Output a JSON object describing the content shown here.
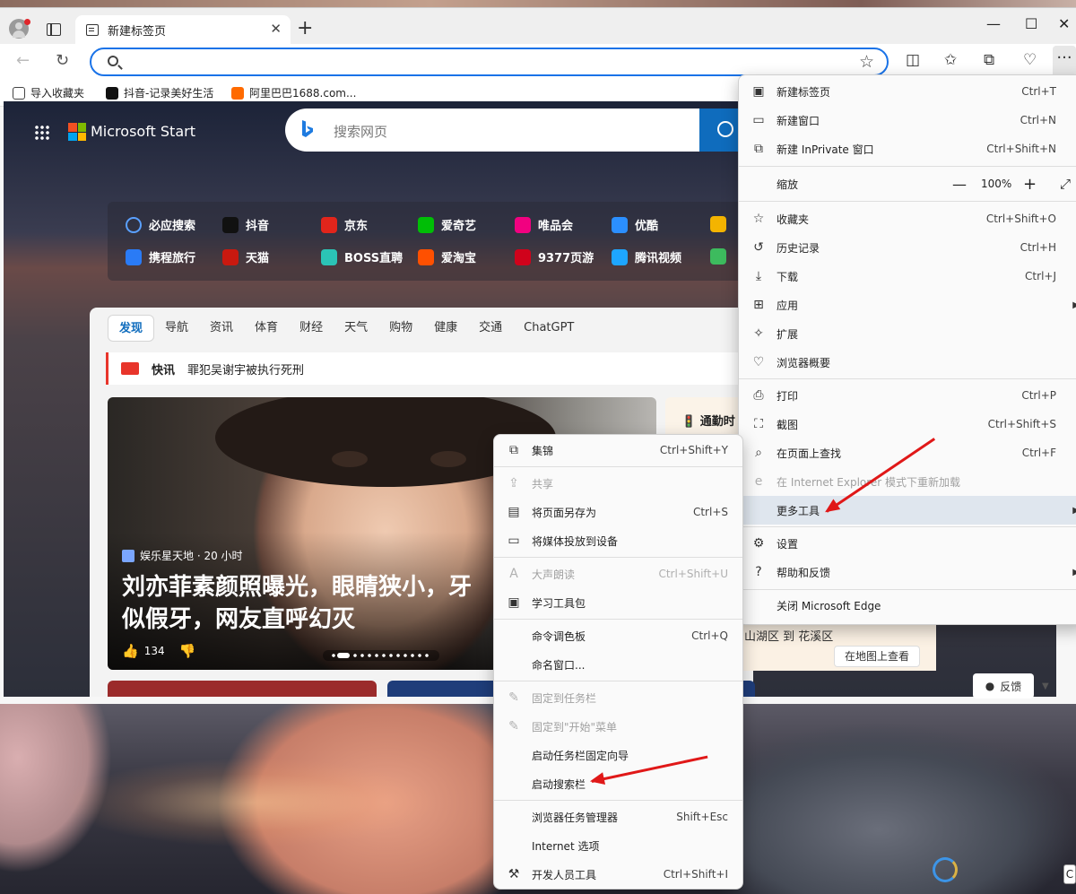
{
  "tab": {
    "title": "新建标签页"
  },
  "address": {
    "value": "",
    "placeholder": ""
  },
  "favorites": [
    {
      "label": "导入收藏夹"
    },
    {
      "label": "抖音-记录美好生活"
    },
    {
      "label": "阿里巴巴1688.com..."
    }
  ],
  "page": {
    "brand": "Microsoft Start",
    "search_placeholder": "搜索网页",
    "quicklinks": [
      {
        "label": "必应搜索",
        "color": "#2f7de1"
      },
      {
        "label": "抖音",
        "color": "#111111"
      },
      {
        "label": "京东",
        "color": "#e1251b"
      },
      {
        "label": "爱奇艺",
        "color": "#00be06"
      },
      {
        "label": "唯品会",
        "color": "#f10180"
      },
      {
        "label": "优酷",
        "color": "#2b8fff"
      },
      {
        "label": "携程旅行",
        "color": "#2a7bf6"
      },
      {
        "label": "天猫",
        "color": "#c9190f"
      },
      {
        "label": "BOSS直聘",
        "color": "#2bc4b6"
      },
      {
        "label": "爱淘宝",
        "color": "#ff5000"
      },
      {
        "label": "9377页游",
        "color": "#d0021b"
      },
      {
        "label": "腾讯视频",
        "color": "#1ea6ff"
      }
    ],
    "feed_tabs": [
      "发现",
      "导航",
      "资讯",
      "体育",
      "财经",
      "天气",
      "购物",
      "健康",
      "交通",
      "ChatGPT"
    ],
    "flash_label": "快讯",
    "flash_text": "罪犯吴谢宇被执行死刑",
    "hero": {
      "source": "娱乐星天地 · 20 小时",
      "title": "刘亦菲素颜照曝光，眼睛狭小，牙\n似假牙，网友直呼幻灭",
      "likes": "134"
    },
    "commute_label": "通勤时",
    "commute_route": "山湖区 到 花溪区",
    "map_button": "在地图上查看",
    "feedback": "反馈"
  },
  "main_menu": {
    "items": [
      {
        "label": "新建标签页",
        "shortcut": "Ctrl+T",
        "icon": "new-tab-icon",
        "glyph": "▣"
      },
      {
        "label": "新建窗口",
        "shortcut": "Ctrl+N",
        "icon": "new-window-icon",
        "glyph": "▭"
      },
      {
        "label": "新建 InPrivate 窗口",
        "shortcut": "Ctrl+Shift+N",
        "icon": "inprivate-icon",
        "glyph": "⧉"
      },
      {
        "label": "缩放",
        "zoom": "100%",
        "minus": "—",
        "plus": "+",
        "full": "⤢"
      },
      {
        "label": "收藏夹",
        "shortcut": "Ctrl+Shift+O",
        "icon": "favorites-icon",
        "glyph": "☆"
      },
      {
        "label": "历史记录",
        "shortcut": "Ctrl+H",
        "icon": "history-icon",
        "glyph": "↺"
      },
      {
        "label": "下载",
        "shortcut": "Ctrl+J",
        "icon": "download-icon",
        "glyph": "⤓"
      },
      {
        "label": "应用",
        "icon": "apps-icon",
        "glyph": "⊞"
      },
      {
        "label": "扩展",
        "icon": "extensions-icon",
        "glyph": "✧"
      },
      {
        "label": "浏览器概要",
        "icon": "browser-essentials-icon",
        "glyph": "♡"
      },
      {
        "label": "打印",
        "shortcut": "Ctrl+P",
        "icon": "print-icon",
        "glyph": "⎙"
      },
      {
        "label": "截图",
        "shortcut": "Ctrl+Shift+S",
        "icon": "screenshot-icon",
        "glyph": "⛶"
      },
      {
        "label": "在页面上查找",
        "shortcut": "Ctrl+F",
        "icon": "find-icon",
        "glyph": "⌕"
      },
      {
        "label": "在 Internet Explorer 模式下重新加载",
        "icon": "ie-icon",
        "glyph": "e"
      },
      {
        "label": "更多工具",
        "icon": "more-tools-icon",
        "glyph": ""
      },
      {
        "label": "设置",
        "icon": "settings-icon",
        "glyph": "⚙"
      },
      {
        "label": "帮助和反馈",
        "icon": "help-icon",
        "glyph": "?"
      },
      {
        "label": "关闭 Microsoft Edge",
        "icon": "close-edge-icon",
        "glyph": ""
      }
    ]
  },
  "sub_menu": {
    "items": [
      {
        "label": "集锦",
        "shortcut": "Ctrl+Shift+Y",
        "icon": "collections-icon",
        "glyph": "⧉"
      },
      {
        "label": "共享",
        "icon": "share-icon",
        "glyph": "⇪"
      },
      {
        "label": "将页面另存为",
        "shortcut": "Ctrl+S",
        "icon": "save-page-icon",
        "glyph": "💾"
      },
      {
        "label": "将媒体投放到设备",
        "icon": "cast-icon",
        "glyph": "▭"
      },
      {
        "label": "大声朗读",
        "shortcut": "Ctrl+Shift+U",
        "icon": "read-aloud-icon",
        "glyph": "A"
      },
      {
        "label": "学习工具包",
        "icon": "learning-toolkit-icon",
        "glyph": "▣"
      },
      {
        "label": "命令调色板",
        "shortcut": "Ctrl+Q",
        "icon": "",
        "glyph": ""
      },
      {
        "label": "命名窗口...",
        "icon": "",
        "glyph": ""
      },
      {
        "label": "固定到任务栏",
        "icon": "pin-taskbar-icon",
        "glyph": "✎"
      },
      {
        "label": "固定到\"开始\"菜单",
        "icon": "pin-start-icon",
        "glyph": "✎"
      },
      {
        "label": "启动任务栏固定向导",
        "icon": "",
        "glyph": ""
      },
      {
        "label": "启动搜索栏",
        "icon": "",
        "glyph": ""
      },
      {
        "label": "浏览器任务管理器",
        "shortcut": "Shift+Esc",
        "icon": "",
        "glyph": ""
      },
      {
        "label": "Internet 选项",
        "icon": "",
        "glyph": ""
      },
      {
        "label": "开发人员工具",
        "shortcut": "Ctrl+Shift+I",
        "icon": "devtools-icon",
        "glyph": "⚒"
      }
    ]
  },
  "colors": {
    "accent": "#1a73e8",
    "menu_hover": "#dfe6ee",
    "annotation": "#e01818"
  }
}
